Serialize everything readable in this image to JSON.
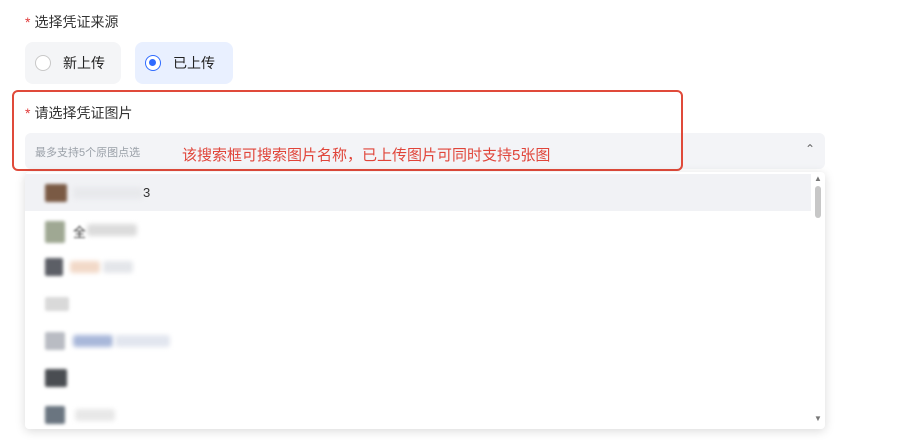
{
  "source_section": {
    "required_mark": "*",
    "label": "选择凭证来源"
  },
  "radios": [
    {
      "label": "新上传",
      "selected": false
    },
    {
      "label": "已上传",
      "selected": true
    }
  ],
  "image_section": {
    "required_mark": "*",
    "label": "请选择凭证图片"
  },
  "search": {
    "placeholder": "最多支持5个原图点选"
  },
  "annotation": {
    "text": "该搜索框可搜索图片名称，已上传图片可同时支持5张图"
  },
  "dropdown_rows": [
    {
      "text_fragment": "3"
    },
    {
      "text_fragment": "全"
    },
    {
      "text_fragment": ""
    },
    {
      "text_fragment": ""
    },
    {
      "text_fragment": ""
    },
    {
      "text_fragment": ""
    },
    {
      "text_fragment": ""
    }
  ],
  "colors": {
    "accent": "#2f6bff",
    "annotation": "#e0453a",
    "required": "#e03a3a"
  },
  "icons": {
    "dropdown_toggle": "chevron-up-icon"
  }
}
